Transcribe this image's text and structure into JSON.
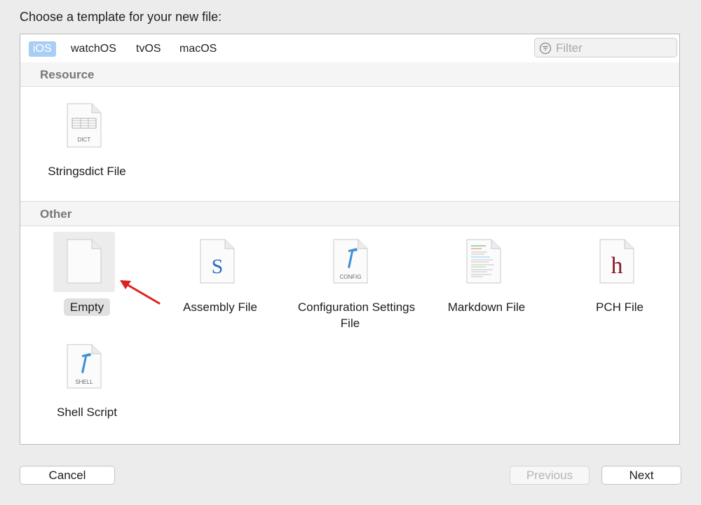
{
  "dialog": {
    "heading": "Choose a template for your new file:"
  },
  "platform_tabs": [
    {
      "label": "iOS",
      "selected": true
    },
    {
      "label": "watchOS",
      "selected": false
    },
    {
      "label": "tvOS",
      "selected": false
    },
    {
      "label": "macOS",
      "selected": false
    }
  ],
  "filter": {
    "placeholder": "Filter",
    "icon": "filter-icon"
  },
  "sections": [
    {
      "title": "Resource",
      "items": [
        {
          "label": "Stringsdict File",
          "icon": "stringsdict-file-icon",
          "badge": "DICT"
        }
      ]
    },
    {
      "title": "Other",
      "items": [
        {
          "label": "Empty",
          "icon": "empty-file-icon",
          "selected": true
        },
        {
          "label": "Assembly File",
          "icon": "assembly-file-icon",
          "glyph": "S"
        },
        {
          "label": "Configuration Settings File",
          "icon": "configuration-settings-file-icon",
          "badge": "CONFIG"
        },
        {
          "label": "Markdown File",
          "icon": "markdown-file-icon"
        },
        {
          "label": "PCH File",
          "icon": "pch-file-icon",
          "glyph": "h"
        },
        {
          "label": "Shell Script",
          "icon": "shell-script-icon",
          "badge": "SHELL"
        }
      ]
    }
  ],
  "annotation": {
    "icon": "red-arrow-icon",
    "color": "#e02020"
  },
  "buttons": {
    "cancel": "Cancel",
    "previous": "Previous",
    "next": "Next"
  },
  "colors": {
    "tab_selected_bg": "#a9cdf4",
    "assembly_glyph": "#2c6fc7",
    "pch_glyph": "#8b1a2b",
    "hammer": "#3d8fd6"
  }
}
